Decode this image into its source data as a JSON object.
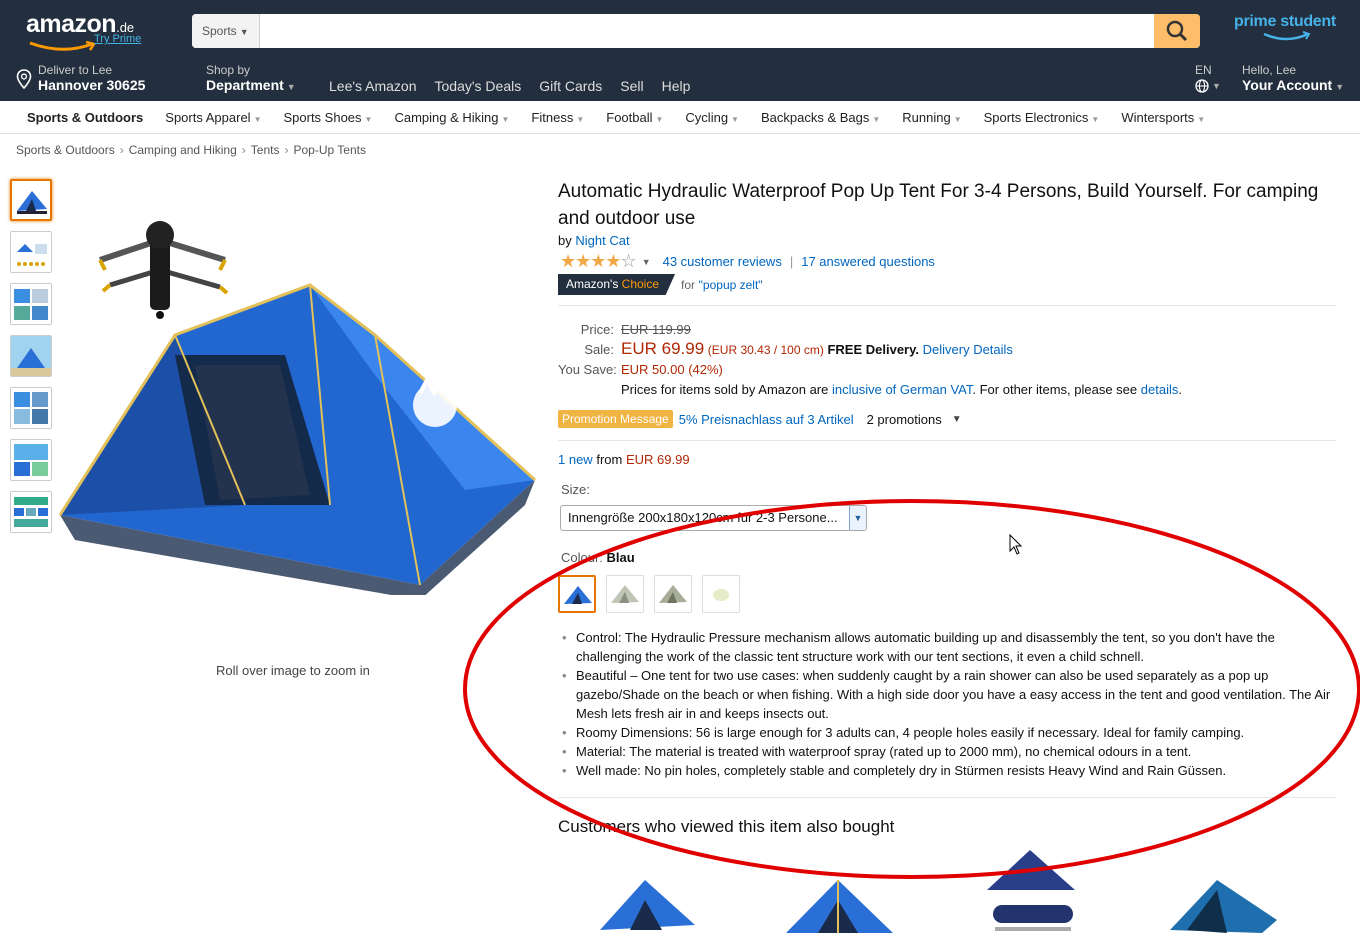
{
  "header": {
    "logo_text": "amazon",
    "logo_tld": ".de",
    "try_prime": "Try Prime",
    "search_category": "Sports",
    "search_value": "",
    "prime_student": "prime student",
    "deliver_small": "Deliver to Lee",
    "deliver_big": "Hannover 30625",
    "shopby_small": "Shop by",
    "shopby_big": "Department",
    "nav_links": [
      "Lee's Amazon",
      "Today's Deals",
      "Gift Cards",
      "Sell",
      "Help"
    ],
    "lang": "EN",
    "hello": "Hello, Lee",
    "account": "Your Account"
  },
  "subnav": [
    "Sports & Outdoors",
    "Sports Apparel",
    "Sports Shoes",
    "Camping & Hiking",
    "Fitness",
    "Football",
    "Cycling",
    "Backpacks & Bags",
    "Running",
    "Sports Electronics",
    "Wintersports"
  ],
  "breadcrumb": [
    "Sports & Outdoors",
    "Camping and Hiking",
    "Tents",
    "Pop-Up Tents"
  ],
  "zoom_hint": "Roll over image to zoom in",
  "product": {
    "title": "Automatic Hydraulic Waterproof Pop Up Tent For 3-4 Persons, Build Yourself. For camping and outdoor use",
    "by": "by",
    "brand": "Night Cat",
    "reviews": "43 customer reviews",
    "separator": "|",
    "questions": "17 answered questions",
    "choice_a": "Amazon's",
    "choice_b": "Choice",
    "choice_for": "for",
    "choice_term": "\"popup zelt\""
  },
  "rating": {
    "value": 4,
    "max": 5
  },
  "pricing": {
    "price_label": "Price:",
    "price": "EUR 119.99",
    "sale_label": "Sale:",
    "sale": "EUR 69.99",
    "unit": "(EUR 30.43 / 100 cm)",
    "free": "FREE Delivery.",
    "delivery_link": "Delivery Details",
    "save_label": "You Save:",
    "save": "EUR 50.00 (42%)",
    "vat_a": "Prices for items sold by Amazon are",
    "vat_link": "inclusive of German VAT",
    "vat_b": ". For other items, please see",
    "vat_details": "details",
    "vat_end": "."
  },
  "promo": {
    "badge": "Promotion Message",
    "link": "5% Preisnachlass auf 3 Artikel",
    "count": "2 promotions"
  },
  "offers": {
    "new_link": "1 new",
    "from": "from",
    "price": "EUR 69.99"
  },
  "size": {
    "label": "Size:",
    "selected": "Innengröße 200x180x120cm für 2-3 Persone..."
  },
  "color": {
    "label": "Colour:",
    "selected": "Blau"
  },
  "bullets": [
    "Control: The Hydraulic Pressure mechanism allows automatic building up and disassembly the tent, so you don't have the challenging the work of the classic tent structure work with our tent sections, it even a child schnell.",
    "Beautiful – One tent for two use cases: when suddenly caught by a rain shower can also be used separately as a pop up gazebo/Shade on the beach or when fishing. With a high side door you have a easy access in the tent and good ventilation. The Air Mesh lets fresh air in and keeps insects out.",
    "Roomy Dimensions: 56 is large enough for 3 adults can, 4 people holes easily if necessary. Ideal for family camping.",
    "Material: The material is treated with waterproof spray (rated up to 2000 mm), no chemical odours in a tent.",
    "Well made: No pin holes, completely stable and completely dry in Stürmen resists Heavy Wind and Rain Güssen."
  ],
  "also_bought_title": "Customers who viewed this item also bought",
  "colors": {
    "header": "#232f3e",
    "accent": "#febd69",
    "link": "#0066c0",
    "price": "#b12704",
    "annotation": "#e00000"
  }
}
